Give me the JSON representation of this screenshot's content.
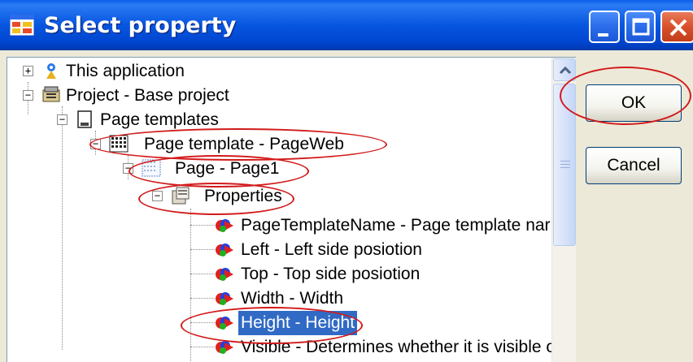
{
  "window": {
    "title": "Select property",
    "icon": "app-window-icon"
  },
  "titlebar_buttons": {
    "minimize": "minimize-icon",
    "maximize": "maximize-icon",
    "close": "close-icon"
  },
  "tree": {
    "items": [
      {
        "label": "This application",
        "icon": "app-icon",
        "expander": "+"
      },
      {
        "label": "Project - Base project",
        "icon": "project-icon",
        "expander": "−"
      },
      {
        "label": "Page templates",
        "icon": "templates-icon",
        "expander": "−"
      },
      {
        "label": "Page template - PageWeb",
        "icon": "template-icon",
        "expander": "−"
      },
      {
        "label": "Page - Page1",
        "icon": "page-icon",
        "expander": "−"
      },
      {
        "label": "Properties",
        "icon": "properties-icon",
        "expander": "−"
      },
      {
        "label": "PageTemplateName - Page template nar",
        "icon": "property-icon"
      },
      {
        "label": "Left - Left side posiotion",
        "icon": "property-icon"
      },
      {
        "label": "Top - Top side posiotion",
        "icon": "property-icon"
      },
      {
        "label": "Width - Width",
        "icon": "property-icon"
      },
      {
        "label": "Height - Height",
        "icon": "property-icon",
        "selected": true
      },
      {
        "label": "Visible - Determines whether it is visible o",
        "icon": "property-icon"
      }
    ]
  },
  "buttons": {
    "ok": "OK",
    "cancel": "Cancel"
  },
  "colors": {
    "titlebar": "#0857e0",
    "selection": "#316ac5",
    "annotation": "#d21a1a",
    "dialog_bg": "#ece9d8"
  }
}
